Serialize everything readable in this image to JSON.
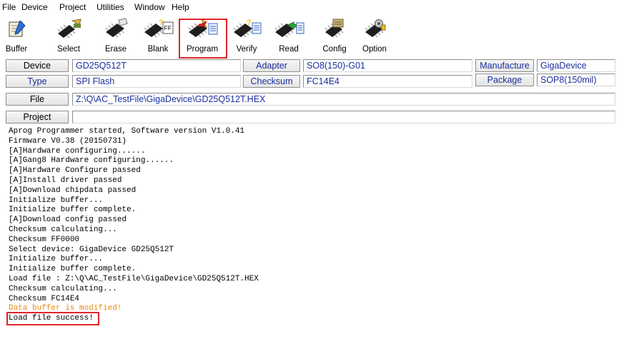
{
  "menu": [
    "File",
    "Device",
    "Project",
    "Utilities",
    "Window",
    "Help"
  ],
  "toolbar": {
    "buttons": [
      {
        "key": "buffer",
        "label": "Buffer",
        "icon": "buffer-icon"
      },
      {
        "key": "select",
        "label": "Select",
        "icon": "select-chip-icon"
      },
      {
        "key": "erase",
        "label": "Erase",
        "icon": "erase-chip-icon"
      },
      {
        "key": "blank",
        "label": "Blank",
        "icon": "blank-check-icon"
      },
      {
        "key": "program",
        "label": "Program",
        "icon": "program-chip-icon",
        "highlighted": true
      },
      {
        "key": "verify",
        "label": "Verify",
        "icon": "verify-chip-icon"
      },
      {
        "key": "read",
        "label": "Read",
        "icon": "read-chip-icon"
      },
      {
        "key": "config",
        "label": "Config",
        "icon": "config-chip-icon"
      },
      {
        "key": "option",
        "label": "Option",
        "icon": "option-chip-icon"
      }
    ],
    "blank_badge": "FF"
  },
  "info": {
    "device_label": "Device",
    "device_value": "GD25Q512T",
    "adapter_label": "Adapter",
    "adapter_value": "SO8(150)-G01",
    "manufacture_label": "Manufacture",
    "manufacture_value": "GigaDevice",
    "type_label": "Type",
    "type_value": "SPI Flash",
    "checksum_label": "Checksum",
    "checksum_value": "FC14E4",
    "package_label": "Package",
    "package_value": "SOP8(150mil)",
    "file_label": "File",
    "file_value": "Z:\\Q\\AC_TestFile\\GigaDevice\\GD25Q512T.HEX",
    "project_label": "Project",
    "project_value": ""
  },
  "log": [
    {
      "text": "Aprog Programmer started, Software version V1.0.41",
      "level": "info"
    },
    {
      "text": "Firmware V0.38 (20150731)",
      "level": "info"
    },
    {
      "text": "[A]Hardware configuring......",
      "level": "info"
    },
    {
      "text": "[A]Gang8 Hardware configuring......",
      "level": "info"
    },
    {
      "text": "[A]Hardware Configure passed",
      "level": "info"
    },
    {
      "text": "[A]Install driver passed",
      "level": "info"
    },
    {
      "text": "[A]Download chipdata passed",
      "level": "info"
    },
    {
      "text": "Initialize buffer...",
      "level": "info"
    },
    {
      "text": "Initialize buffer complete.",
      "level": "info"
    },
    {
      "text": "[A]Download config passed",
      "level": "info"
    },
    {
      "text": "Checksum calculating...",
      "level": "info"
    },
    {
      "text": "Checksum FF0000",
      "level": "info"
    },
    {
      "text": "Select device: GigaDevice GD25Q512T",
      "level": "info"
    },
    {
      "text": "Initialize buffer...",
      "level": "info"
    },
    {
      "text": "Initialize buffer complete.",
      "level": "info"
    },
    {
      "text": "Load file : Z:\\Q\\AC_TestFile\\GigaDevice\\GD25Q512T.HEX",
      "level": "info"
    },
    {
      "text": "Checksum calculating...",
      "level": "info"
    },
    {
      "text": "Checksum FC14E4",
      "level": "info"
    },
    {
      "text": "Data buffer is modified!",
      "level": "warning"
    },
    {
      "text": "Load file success!",
      "level": "info",
      "highlighted": true
    }
  ],
  "colors": {
    "highlight": "#e0242a",
    "value_text": "#1a2f9c",
    "warning_text": "#e8891a"
  }
}
